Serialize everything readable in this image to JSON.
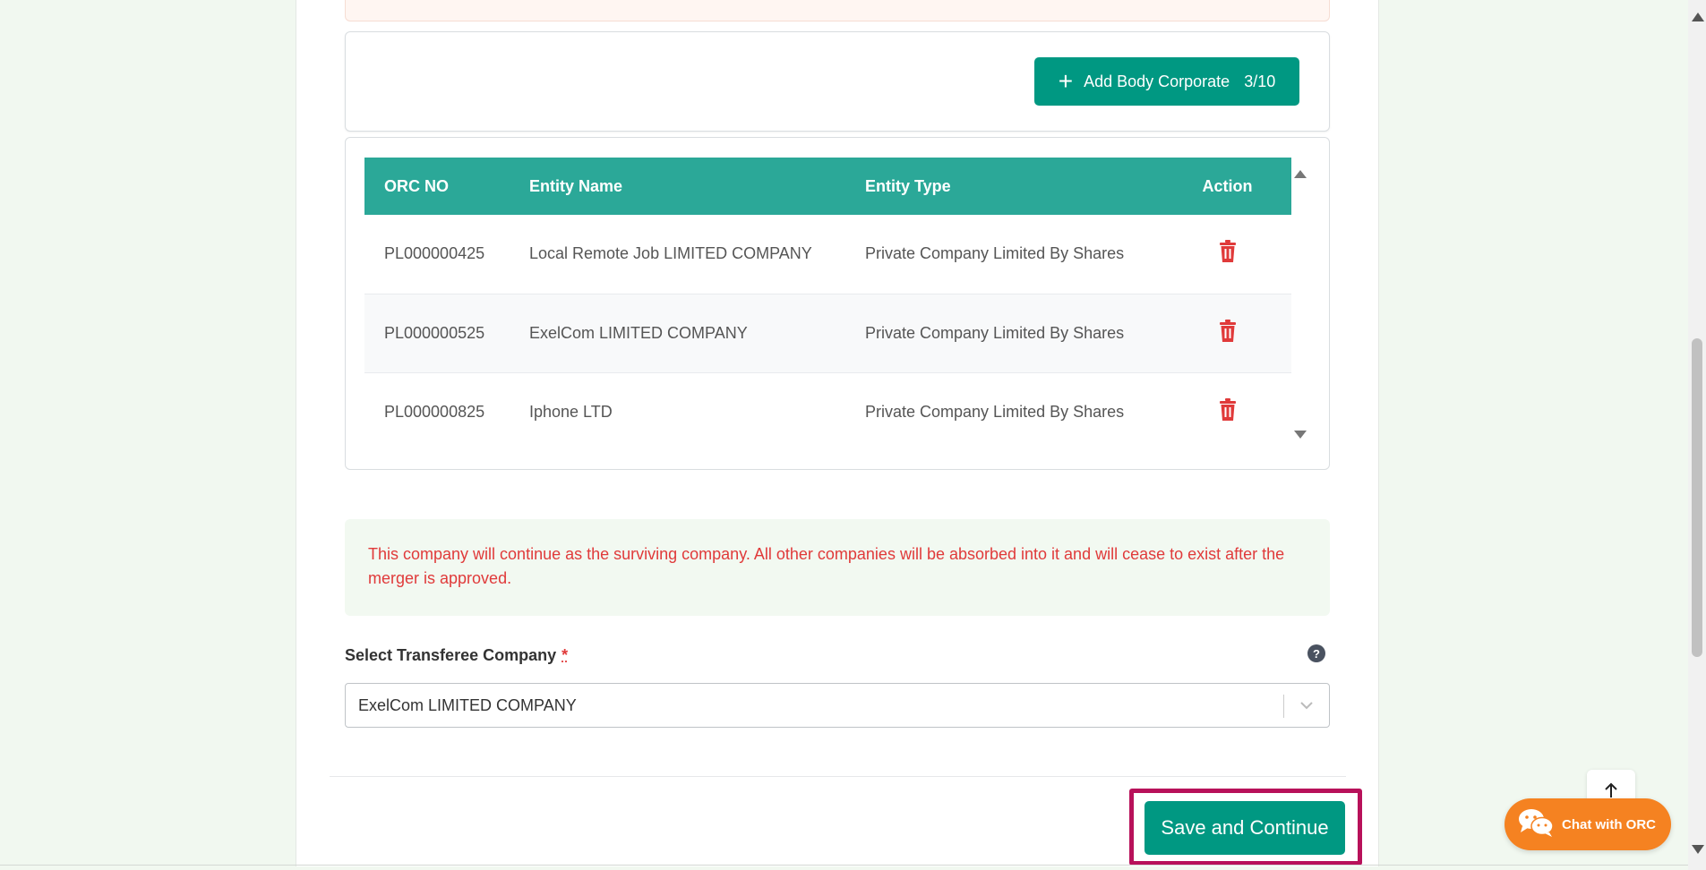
{
  "add_card": {
    "button_label": "Add Body Corporate",
    "button_count": "3/10"
  },
  "table": {
    "headers": {
      "orc_no": "ORC NO",
      "entity_name": "Entity Name",
      "entity_type": "Entity Type",
      "action": "Action"
    },
    "rows": [
      {
        "orc_no": "PL000000425",
        "entity_name": "Local Remote Job LIMITED COMPANY",
        "entity_type": "Private Company Limited By Shares"
      },
      {
        "orc_no": "PL000000525",
        "entity_name": "ExelCom LIMITED COMPANY",
        "entity_type": "Private Company Limited By Shares"
      },
      {
        "orc_no": "PL000000825",
        "entity_name": "Iphone LTD",
        "entity_type": "Private Company Limited By Shares"
      }
    ]
  },
  "notice": {
    "text": "This company will continue as the surviving company. All other companies will be absorbed into it and will cease to exist after the merger is approved."
  },
  "transferee": {
    "label": "Select Transferee Company",
    "required_mark": "*",
    "help": "?",
    "selected_value": "ExelCom LIMITED COMPANY"
  },
  "footer": {
    "save_label": "Save and Continue"
  },
  "chat": {
    "label": "Chat with ORC"
  },
  "colors": {
    "primary": "#009882",
    "table_header": "#2ba898",
    "danger": "#e03a3a",
    "chat": "#f58221",
    "highlight": "#b8115a"
  }
}
